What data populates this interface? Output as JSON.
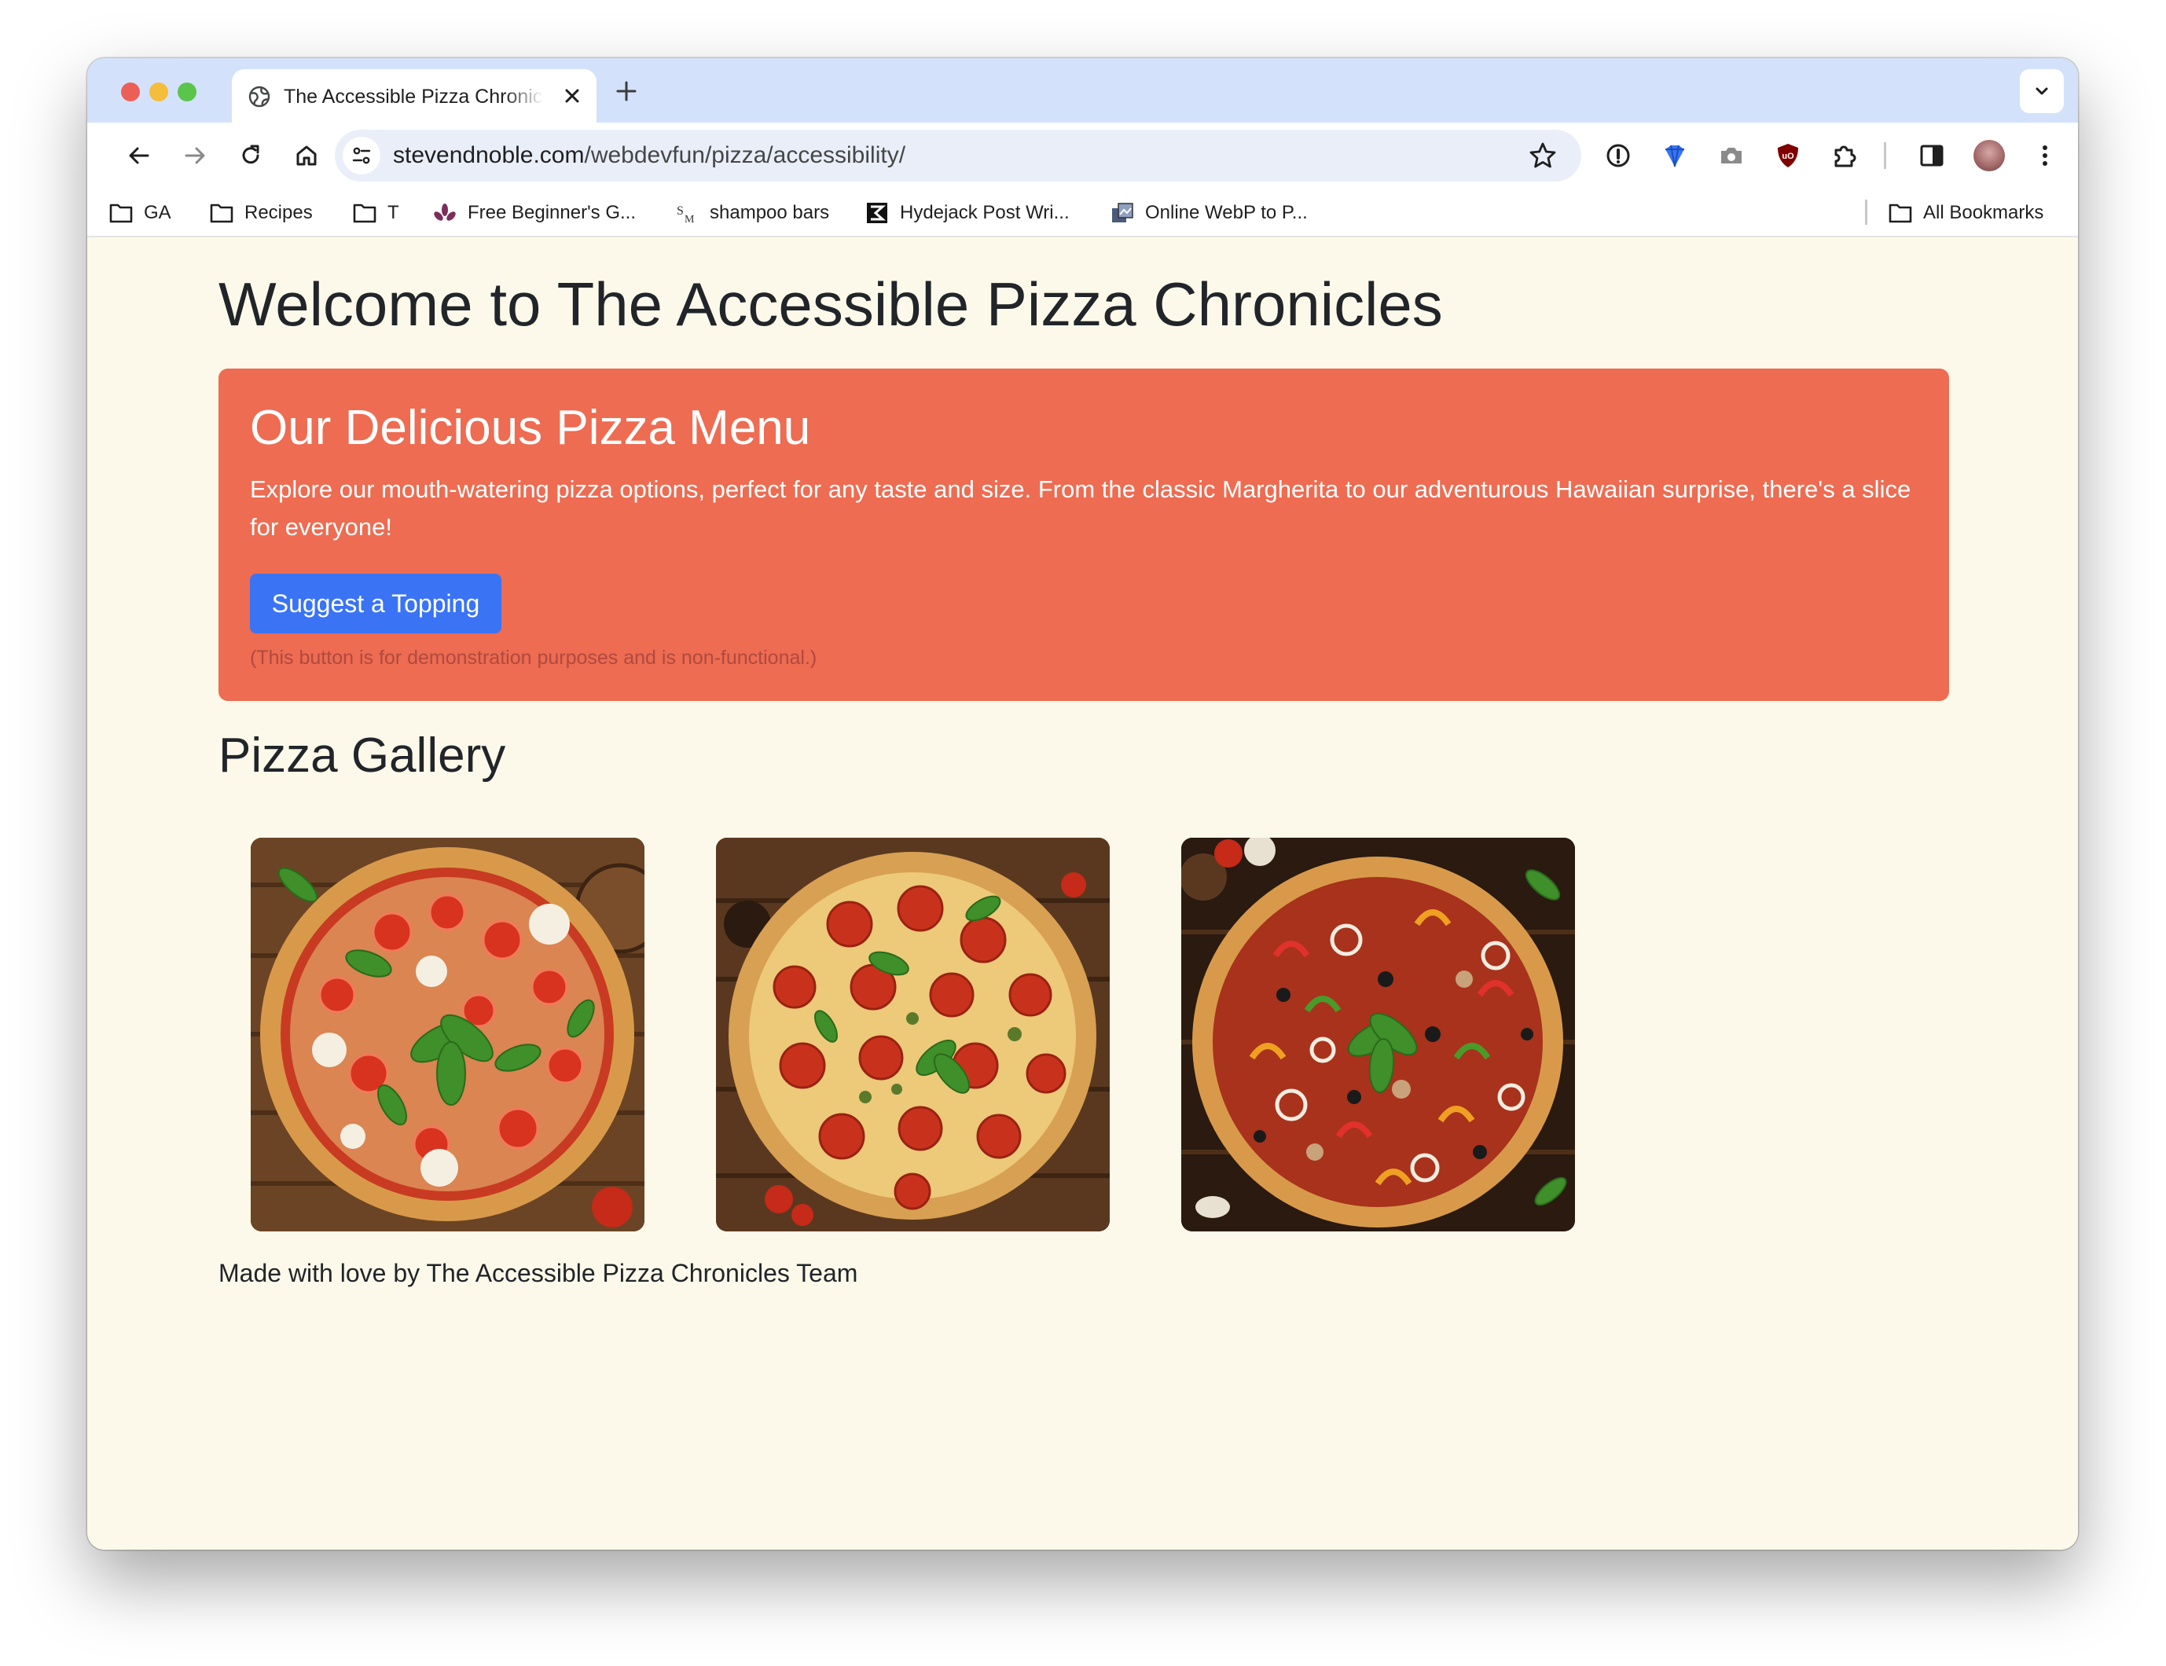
{
  "browser": {
    "tab_title": "The Accessible Pizza Chronicles",
    "url_host": "stevendnoble.com",
    "url_path": "/webdevfun/pizza/accessibility/",
    "bookmarks": [
      {
        "label": "GA",
        "icon": "folder-icon"
      },
      {
        "label": "Recipes",
        "icon": "folder-icon"
      },
      {
        "label": "T",
        "icon": "folder-icon"
      },
      {
        "label": "Free Beginner's G...",
        "icon": "site-favicon"
      },
      {
        "label": "shampoo bars",
        "icon": "site-favicon"
      },
      {
        "label": "Hydejack Post Wri...",
        "icon": "site-favicon"
      },
      {
        "label": "Online WebP to P...",
        "icon": "site-favicon"
      }
    ],
    "all_bookmarks_label": "All Bookmarks"
  },
  "page": {
    "title": "Welcome to The Accessible Pizza Chronicles",
    "hero": {
      "heading": "Our Delicious Pizza Menu",
      "text": "Explore our mouth-watering pizza options, perfect for any taste and size. From the classic Margherita to our adventurous Hawaiian surprise, there's a slice for everyone!",
      "button_label": "Suggest a Topping",
      "note": "(This button is for demonstration purposes and is non-functional.)"
    },
    "gallery_title": "Pizza Gallery",
    "gallery": [
      {
        "name": "margherita",
        "toppings": "tomato, mozzarella, basil"
      },
      {
        "name": "pepperoni",
        "toppings": "pepperoni, basil, olives"
      },
      {
        "name": "veggie",
        "toppings": "peppers, onions, olives, mushrooms, basil"
      }
    ],
    "footer": "Made with love by The Accessible Pizza Chronicles Team"
  },
  "colors": {
    "page_bg": "#fdf9ea",
    "hero_bg": "#ed6c52",
    "button_bg": "#3a74f5",
    "tabstrip_bg": "#d3e2fa",
    "text": "#212529"
  }
}
